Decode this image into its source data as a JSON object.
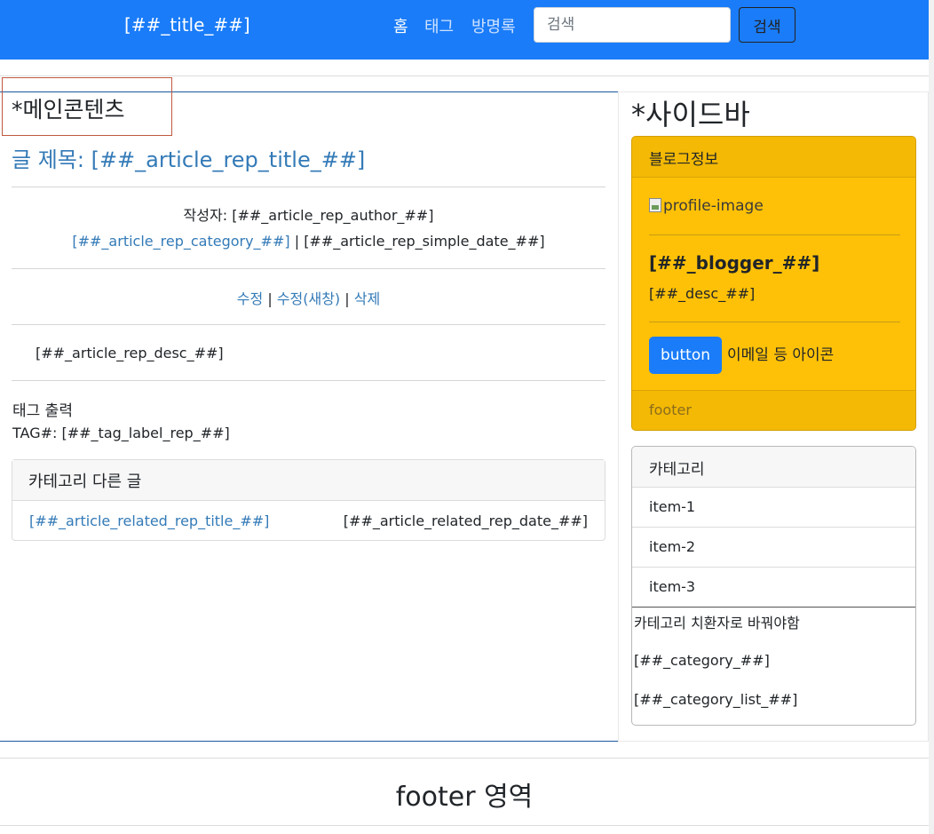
{
  "navbar": {
    "brand": "[##_title_##]",
    "links": [
      "홈",
      "태그",
      "방명록"
    ],
    "search_placeholder": "검색",
    "search_button": "검색"
  },
  "main": {
    "heading": "*메인콘텐츠",
    "article_title": "글 제목: [##_article_rep_title_##]",
    "author_label": "작성자:",
    "author": "[##_article_rep_author_##]",
    "category": "[##_article_rep_category_##]",
    "separator": "|",
    "date": "[##_article_rep_simple_date_##]",
    "actions": [
      "수정",
      "수정(새창)",
      "삭제"
    ],
    "desc": "[##_article_rep_desc_##]",
    "tag_heading": "태그 출력",
    "tag_label": "TAG#:",
    "tag_value": "[##_tag_label_rep_##]",
    "related": {
      "header": "카테고리 다른 글",
      "title": "[##_article_related_rep_title_##]",
      "date": "[##_article_related_rep_date_##]"
    }
  },
  "sidebar": {
    "heading": "*사이드바",
    "blog_card": {
      "header": "블로그정보",
      "image_alt": "profile-image",
      "blogger": "[##_blogger_##]",
      "desc": "[##_desc_##]",
      "button": "button",
      "icon_text": "이메일 등 아이콘",
      "footer": "footer"
    },
    "category_card": {
      "header": "카테고리",
      "items": [
        "item-1",
        "item-2",
        "item-3"
      ],
      "note": "카테고리 치환자로 바꿔야함",
      "category": "[##_category_##]",
      "category_list": "[##_category_list_##]"
    }
  },
  "footer": {
    "title": "footer 영역"
  },
  "colors": {
    "navbar": "#1a7cf8",
    "link": "#337ab7",
    "warning_card": "#ffc107"
  }
}
